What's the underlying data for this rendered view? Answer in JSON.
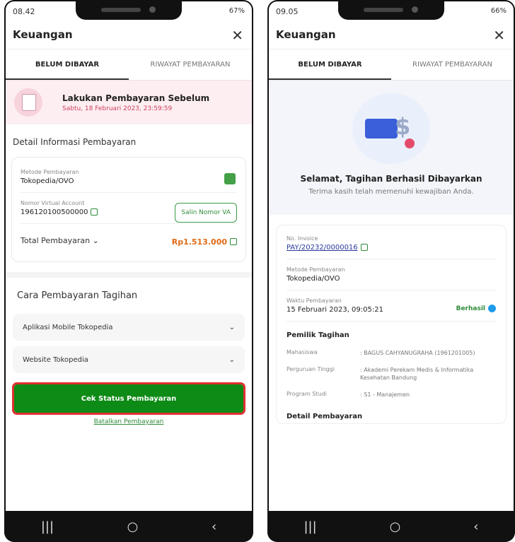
{
  "left": {
    "status": {
      "time": "08.42",
      "right": "67%"
    },
    "app_title": "Keuangan",
    "tabs": [
      "BELUM DIBAYAR",
      "RIWAYAT PEMBAYARAN"
    ],
    "deadline": {
      "title": "Lakukan Pembayaran Sebelum",
      "date": "Sabtu, 18 Februari 2023, 23:59:59"
    },
    "detail_title": "Detail Informasi Pembayaran",
    "method": {
      "label": "Metode Pembayaran",
      "value": "Tokopedia/OVO"
    },
    "va": {
      "label": "Nomor Virtual Account",
      "value": "196120100500000",
      "button": "Salin Nomor VA"
    },
    "total": {
      "label": "Total Pembayaran ⌄",
      "value": "Rp1.513.000"
    },
    "cara_title": "Cara Pembayaran Tagihan",
    "accordions": [
      "Aplikasi Mobile Tokopedia",
      "Website Tokopedia"
    ],
    "primary_button": "Cek Status Pembayaran",
    "cancel_link": "Batalkan Pembayaran"
  },
  "right": {
    "status": {
      "time": "09.05",
      "right": "66%"
    },
    "app_title": "Keuangan",
    "tabs": [
      "BELUM DIBAYAR",
      "RIWAYAT PEMBAYARAN"
    ],
    "success_title": "Selamat, Tagihan Berhasil Dibayarkan",
    "success_sub": "Terima kasih telah memenuhi kewajiban Anda.",
    "invoice": {
      "label": "No. Invoice",
      "value": "PAY/20232/0000016"
    },
    "method": {
      "label": "Metode Pembayaran",
      "value": "Tokopedia/OVO"
    },
    "time": {
      "label": "Waktu Pembayaran",
      "value": "15 Februari 2023, 09:05:21",
      "status": "Berhasil"
    },
    "owner_title": "Pemilik Tagihan",
    "owner": [
      {
        "k": "Mahasiswa",
        "v": ": BAGUS CAHYANUGRAHA (1961201005)"
      },
      {
        "k": "Perguruan Tinggi",
        "v": ": Akademi Perekam Medis & Informatika Kesehatan Bandung"
      },
      {
        "k": "Program Studi",
        "v": ": S1 - Manajemen"
      }
    ],
    "detail_title": "Detail Pembayaran"
  },
  "nav_icons": {
    "recent": "|||",
    "home": "○",
    "back": "‹"
  }
}
